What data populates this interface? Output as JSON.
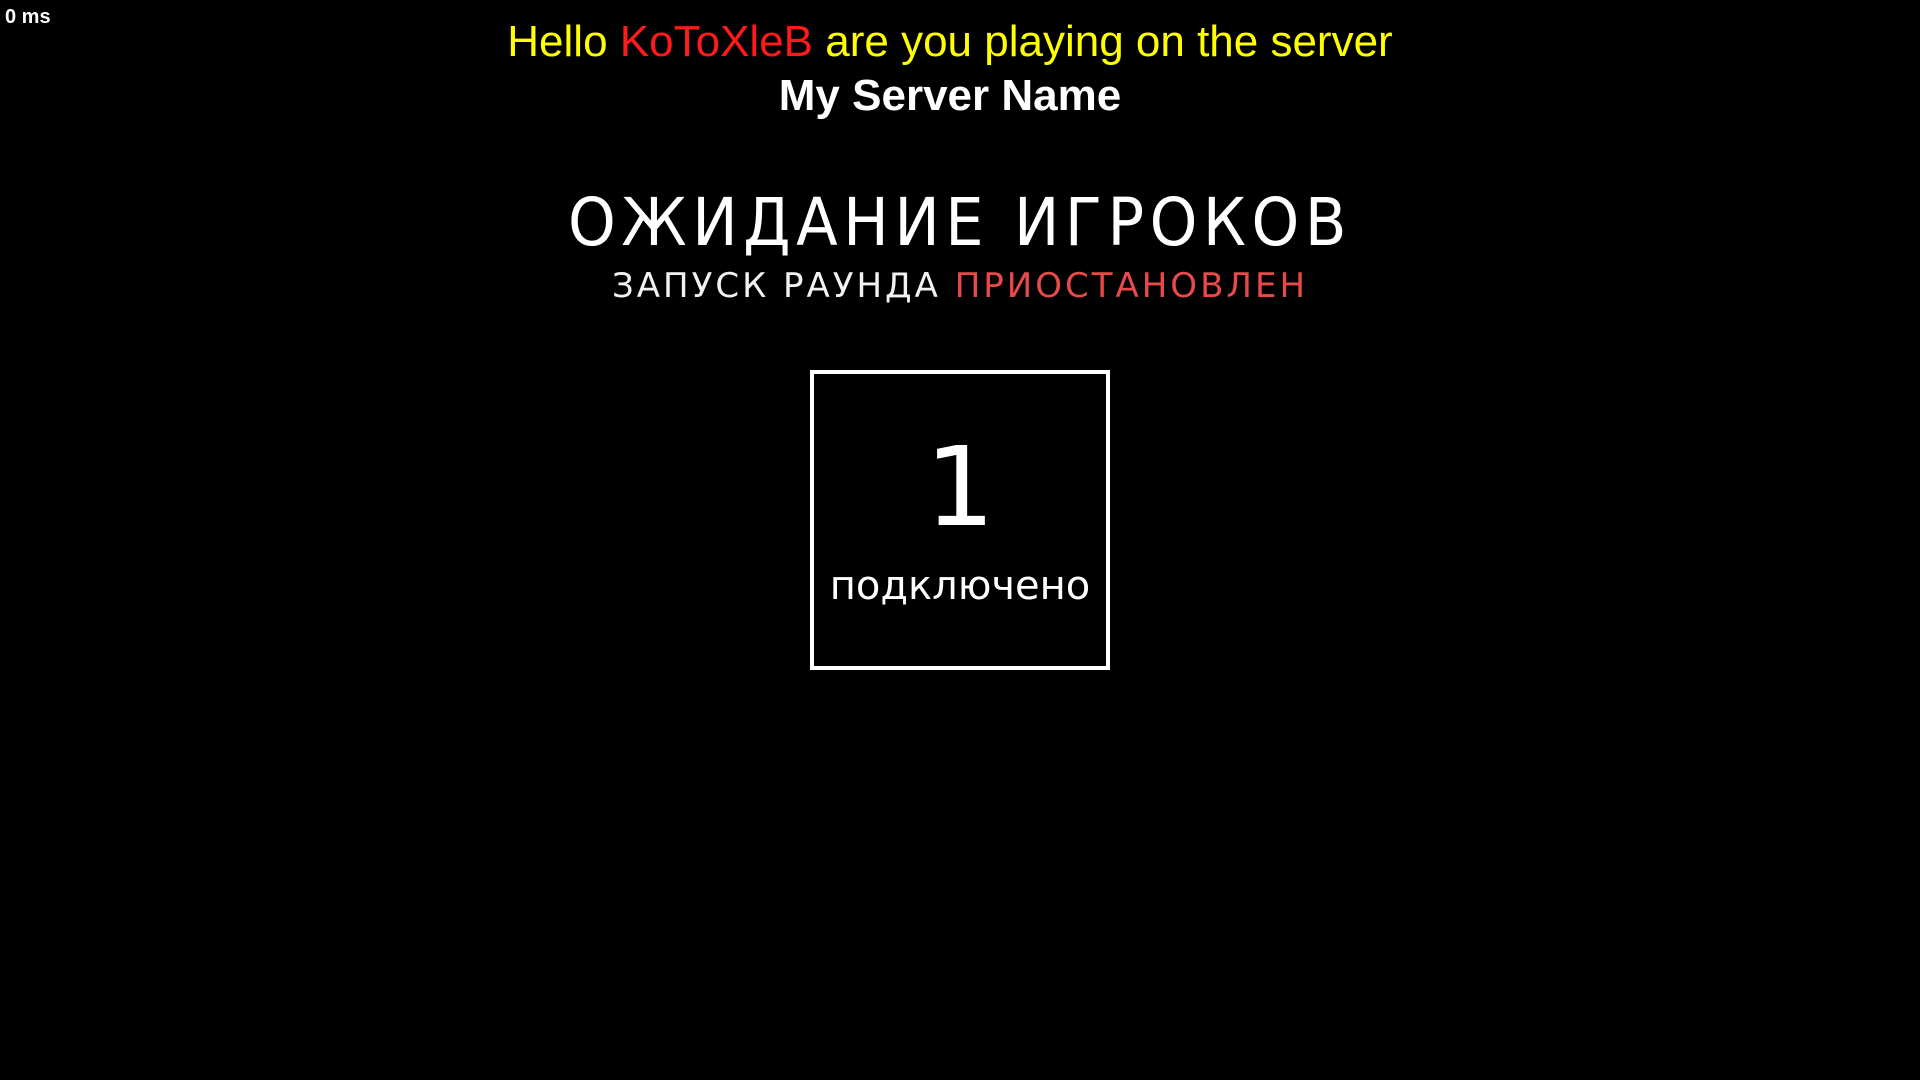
{
  "hud": {
    "ping": "0 ms"
  },
  "greeting": {
    "prefix": "Hello",
    "player_name": "KoToXleB",
    "suffix": "are you playing on the server",
    "server_name": "My Server Name",
    "colors": {
      "text": "#ffff00",
      "player_name": "#ff1a1a",
      "server_name": "#ffffff"
    }
  },
  "lobby": {
    "title": "ОЖИДАНИЕ ИГРОКОВ",
    "round_status_label": "ЗАПУСК РАУНДА",
    "round_status_value": "ПРИОСТАНОВЛЕН",
    "colors": {
      "title": "#ffffff",
      "status_label": "#f2f2f2",
      "status_value": "#e84a4a"
    }
  },
  "players": {
    "connected_count": "1",
    "connected_label": "подключено"
  }
}
